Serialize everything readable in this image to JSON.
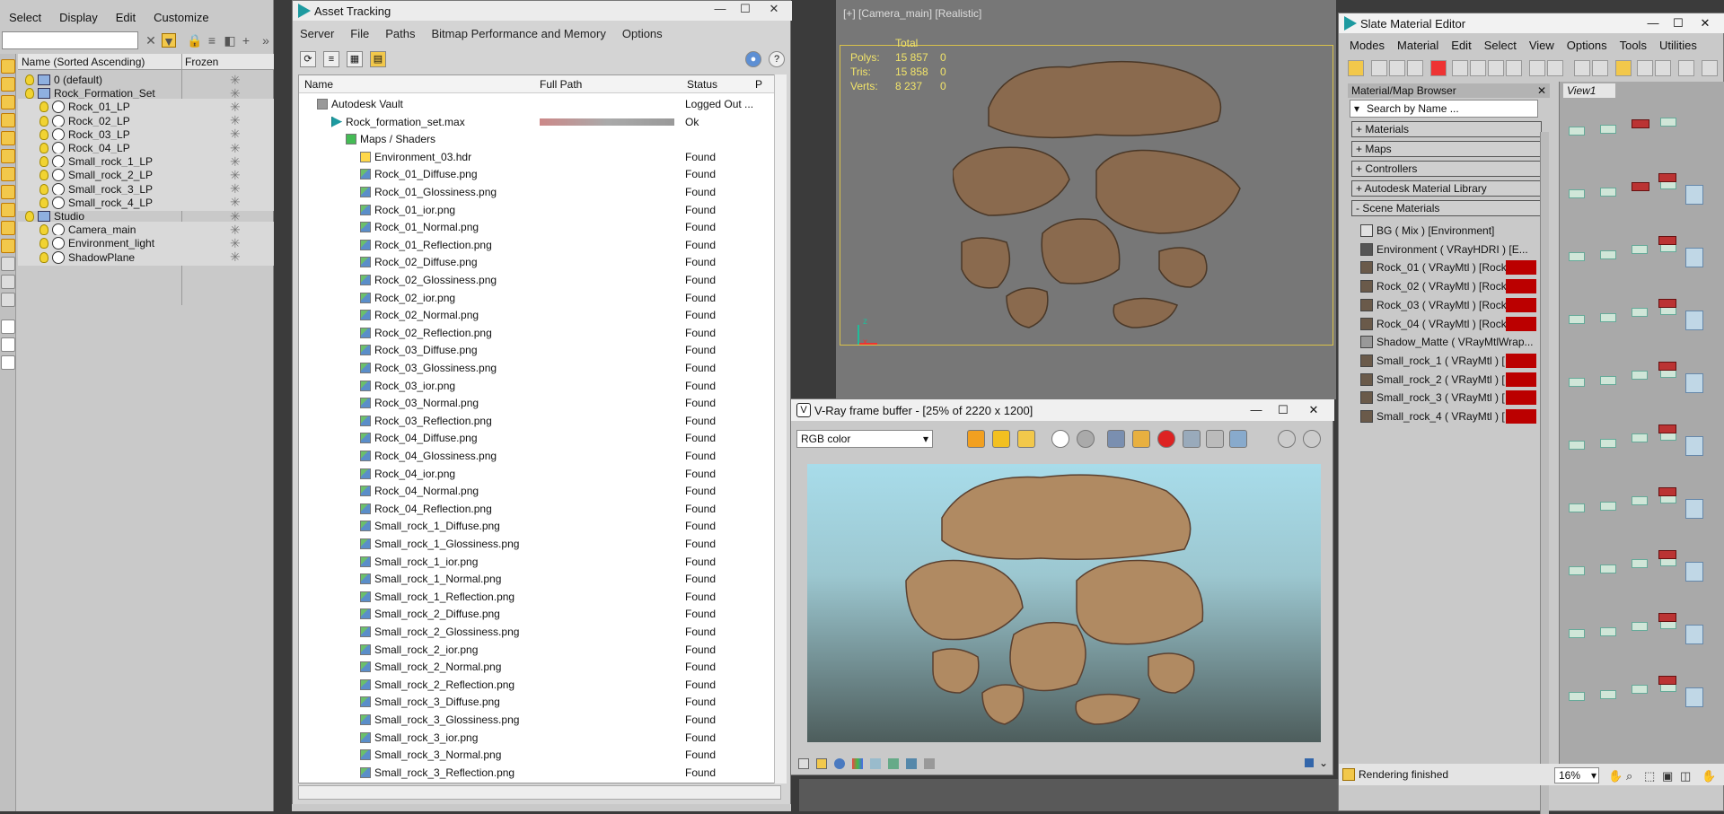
{
  "scene_explorer": {
    "menu": [
      "Select",
      "Display",
      "Edit",
      "Customize"
    ],
    "columns": {
      "name": "Name (Sorted Ascending)",
      "frozen": "Frozen"
    },
    "rows": [
      {
        "label": "0 (default)",
        "type": "layer",
        "indent": 1
      },
      {
        "label": "Rock_Formation_Set",
        "type": "layer",
        "indent": 1
      },
      {
        "label": "Rock_01_LP",
        "type": "object",
        "indent": 2
      },
      {
        "label": "Rock_02_LP",
        "type": "object",
        "indent": 2
      },
      {
        "label": "Rock_03_LP",
        "type": "object",
        "indent": 2
      },
      {
        "label": "Rock_04_LP",
        "type": "object",
        "indent": 2
      },
      {
        "label": "Small_rock_1_LP",
        "type": "object",
        "indent": 2
      },
      {
        "label": "Small_rock_2_LP",
        "type": "object",
        "indent": 2
      },
      {
        "label": "Small_rock_3_LP",
        "type": "object",
        "indent": 2
      },
      {
        "label": "Small_rock_4_LP",
        "type": "object",
        "indent": 2
      },
      {
        "label": "Studio",
        "type": "layer",
        "indent": 1
      },
      {
        "label": "Camera_main",
        "type": "camera",
        "indent": 2
      },
      {
        "label": "Environment_light",
        "type": "light",
        "indent": 2
      },
      {
        "label": "ShadowPlane",
        "type": "object",
        "indent": 2
      }
    ]
  },
  "asset_tracking": {
    "title": "Asset Tracking",
    "menu": [
      "Server",
      "File",
      "Paths",
      "Bitmap Performance and Memory",
      "Options"
    ],
    "columns": {
      "name": "Name",
      "path": "Full Path",
      "status": "Status",
      "p": "P"
    },
    "rows": [
      {
        "name": "Autodesk Vault",
        "status": "Logged Out ...",
        "icon": "vault",
        "indent": 1
      },
      {
        "name": "Rock_formation_set.max",
        "status": "Ok",
        "icon": "max",
        "indent": 2,
        "path_blurred": true
      },
      {
        "name": "Maps / Shaders",
        "status": "",
        "icon": "fold",
        "indent": 3
      },
      {
        "name": "Environment_03.hdr",
        "status": "Found",
        "icon": "hdr",
        "indent": 4
      },
      {
        "name": "Rock_01_Diffuse.png",
        "status": "Found",
        "icon": "img",
        "indent": 4
      },
      {
        "name": "Rock_01_Glossiness.png",
        "status": "Found",
        "icon": "img",
        "indent": 4
      },
      {
        "name": "Rock_01_ior.png",
        "status": "Found",
        "icon": "img",
        "indent": 4
      },
      {
        "name": "Rock_01_Normal.png",
        "status": "Found",
        "icon": "img",
        "indent": 4
      },
      {
        "name": "Rock_01_Reflection.png",
        "status": "Found",
        "icon": "img",
        "indent": 4
      },
      {
        "name": "Rock_02_Diffuse.png",
        "status": "Found",
        "icon": "img",
        "indent": 4
      },
      {
        "name": "Rock_02_Glossiness.png",
        "status": "Found",
        "icon": "img",
        "indent": 4
      },
      {
        "name": "Rock_02_ior.png",
        "status": "Found",
        "icon": "img",
        "indent": 4
      },
      {
        "name": "Rock_02_Normal.png",
        "status": "Found",
        "icon": "img",
        "indent": 4
      },
      {
        "name": "Rock_02_Reflection.png",
        "status": "Found",
        "icon": "img",
        "indent": 4
      },
      {
        "name": "Rock_03_Diffuse.png",
        "status": "Found",
        "icon": "img",
        "indent": 4
      },
      {
        "name": "Rock_03_Glossiness.png",
        "status": "Found",
        "icon": "img",
        "indent": 4
      },
      {
        "name": "Rock_03_ior.png",
        "status": "Found",
        "icon": "img",
        "indent": 4
      },
      {
        "name": "Rock_03_Normal.png",
        "status": "Found",
        "icon": "img",
        "indent": 4
      },
      {
        "name": "Rock_03_Reflection.png",
        "status": "Found",
        "icon": "img",
        "indent": 4
      },
      {
        "name": "Rock_04_Diffuse.png",
        "status": "Found",
        "icon": "img",
        "indent": 4
      },
      {
        "name": "Rock_04_Glossiness.png",
        "status": "Found",
        "icon": "img",
        "indent": 4
      },
      {
        "name": "Rock_04_ior.png",
        "status": "Found",
        "icon": "img",
        "indent": 4
      },
      {
        "name": "Rock_04_Normal.png",
        "status": "Found",
        "icon": "img",
        "indent": 4
      },
      {
        "name": "Rock_04_Reflection.png",
        "status": "Found",
        "icon": "img",
        "indent": 4
      },
      {
        "name": "Small_rock_1_Diffuse.png",
        "status": "Found",
        "icon": "img",
        "indent": 4
      },
      {
        "name": "Small_rock_1_Glossiness.png",
        "status": "Found",
        "icon": "img",
        "indent": 4
      },
      {
        "name": "Small_rock_1_ior.png",
        "status": "Found",
        "icon": "img",
        "indent": 4
      },
      {
        "name": "Small_rock_1_Normal.png",
        "status": "Found",
        "icon": "img",
        "indent": 4
      },
      {
        "name": "Small_rock_1_Reflection.png",
        "status": "Found",
        "icon": "img",
        "indent": 4
      },
      {
        "name": "Small_rock_2_Diffuse.png",
        "status": "Found",
        "icon": "img",
        "indent": 4
      },
      {
        "name": "Small_rock_2_Glossiness.png",
        "status": "Found",
        "icon": "img",
        "indent": 4
      },
      {
        "name": "Small_rock_2_ior.png",
        "status": "Found",
        "icon": "img",
        "indent": 4
      },
      {
        "name": "Small_rock_2_Normal.png",
        "status": "Found",
        "icon": "img",
        "indent": 4
      },
      {
        "name": "Small_rock_2_Reflection.png",
        "status": "Found",
        "icon": "img",
        "indent": 4
      },
      {
        "name": "Small_rock_3_Diffuse.png",
        "status": "Found",
        "icon": "img",
        "indent": 4
      },
      {
        "name": "Small_rock_3_Glossiness.png",
        "status": "Found",
        "icon": "img",
        "indent": 4
      },
      {
        "name": "Small_rock_3_ior.png",
        "status": "Found",
        "icon": "img",
        "indent": 4
      },
      {
        "name": "Small_rock_3_Normal.png",
        "status": "Found",
        "icon": "img",
        "indent": 4
      },
      {
        "name": "Small_rock_3_Reflection.png",
        "status": "Found",
        "icon": "img",
        "indent": 4
      }
    ]
  },
  "viewport": {
    "label": "[+] [Camera_main] [Realistic]",
    "stats_header": "Total",
    "stats": [
      {
        "key": "Polys:",
        "total": "15 857",
        "sel": "0"
      },
      {
        "key": "Tris:",
        "total": "15 858",
        "sel": "0"
      },
      {
        "key": "Verts:",
        "total": "8 237",
        "sel": "0"
      }
    ],
    "axis_z": "z",
    "axis_x": "x"
  },
  "vfb": {
    "title": "V-Ray frame buffer - [25% of 2220 x 1200]",
    "channel": "RGB color"
  },
  "slate": {
    "title": "Slate Material Editor",
    "menu": [
      "Modes",
      "Material",
      "Edit",
      "Select",
      "View",
      "Options",
      "Tools",
      "Utilities"
    ],
    "browser_title": "Material/Map Browser",
    "search_placeholder": "Search by Name ...",
    "sections": [
      "+ Materials",
      "+ Maps",
      "+ Controllers",
      "+ Autodesk Material Library",
      "- Scene Materials"
    ],
    "materials": [
      {
        "label": "BG  ( Mix )  [Environment]",
        "red": false,
        "swatch": "#e0e0e0"
      },
      {
        "label": "Environment  ( VRayHDRI )  [E...",
        "red": false,
        "swatch": "#555"
      },
      {
        "label": "Rock_01  ( VRayMtl )  [Rock",
        "red": true,
        "swatch": "#6a5a4a"
      },
      {
        "label": "Rock_02  ( VRayMtl )  [Rock",
        "red": true,
        "swatch": "#6a5a4a"
      },
      {
        "label": "Rock_03  ( VRayMtl )  [Rock",
        "red": true,
        "swatch": "#6a5a4a"
      },
      {
        "label": "Rock_04  ( VRayMtl )  [Rock",
        "red": true,
        "swatch": "#6a5a4a"
      },
      {
        "label": "Shadow_Matte  ( VRayMtlWrap...",
        "red": false,
        "swatch": "#999"
      },
      {
        "label": "Small_rock_1  ( VRayMtl )  [",
        "red": true,
        "swatch": "#6a5a4a"
      },
      {
        "label": "Small_rock_2  ( VRayMtl )  [",
        "red": true,
        "swatch": "#6a5a4a"
      },
      {
        "label": "Small_rock_3  ( VRayMtl )  [",
        "red": true,
        "swatch": "#6a5a4a"
      },
      {
        "label": "Small_rock_4  ( VRayMtl )  [",
        "red": true,
        "swatch": "#6a5a4a"
      }
    ],
    "view_tab": "View1",
    "status": "Rendering finished",
    "zoom": "16%"
  }
}
